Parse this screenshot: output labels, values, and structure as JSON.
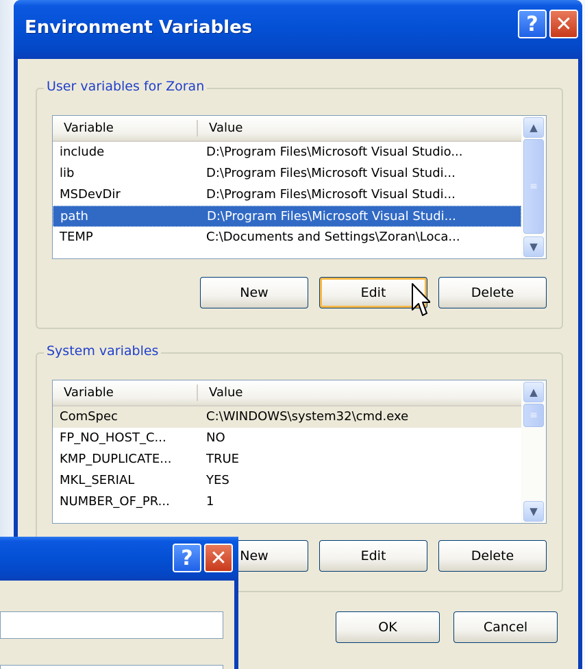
{
  "window": {
    "title": "Environment Variables",
    "help_glyph": "?",
    "close_glyph": "✕"
  },
  "user_section": {
    "legend": "User variables for Zoran",
    "col_variable": "Variable",
    "col_value": "Value",
    "rows": [
      {
        "variable": "include",
        "value": "D:\\Program Files\\Microsoft Visual Studio..."
      },
      {
        "variable": "lib",
        "value": "D:\\Program Files\\Microsoft Visual Studi..."
      },
      {
        "variable": "MSDevDir",
        "value": "D:\\Program Files\\Microsoft Visual Studi..."
      },
      {
        "variable": "path",
        "value": "D:\\Program Files\\Microsoft Visual Studi...",
        "selected": true
      },
      {
        "variable": "TEMP",
        "value": "C:\\Documents and Settings\\Zoran\\Loca..."
      }
    ],
    "buttons": {
      "new": "New",
      "edit": "Edit",
      "delete": "Delete"
    }
  },
  "system_section": {
    "legend": "System variables",
    "col_variable": "Variable",
    "col_value": "Value",
    "rows": [
      {
        "variable": "ComSpec",
        "value": "C:\\WINDOWS\\system32\\cmd.exe",
        "highlighted": true
      },
      {
        "variable": "FP_NO_HOST_C...",
        "value": "NO"
      },
      {
        "variable": "KMP_DUPLICATE...",
        "value": "TRUE"
      },
      {
        "variable": "MKL_SERIAL",
        "value": "YES"
      },
      {
        "variable": "NUMBER_OF_PR...",
        "value": "1"
      }
    ],
    "buttons": {
      "new": "New",
      "edit": "Edit",
      "delete": "Delete"
    }
  },
  "footer": {
    "ok": "OK",
    "cancel": "Cancel"
  },
  "overlay_dialog": {
    "help_glyph": "?",
    "close_glyph": "✕"
  },
  "icons": {
    "scroll_up": "chevron-up-icon",
    "scroll_down": "chevron-down-icon",
    "cursor": "mouse-pointer-icon"
  }
}
